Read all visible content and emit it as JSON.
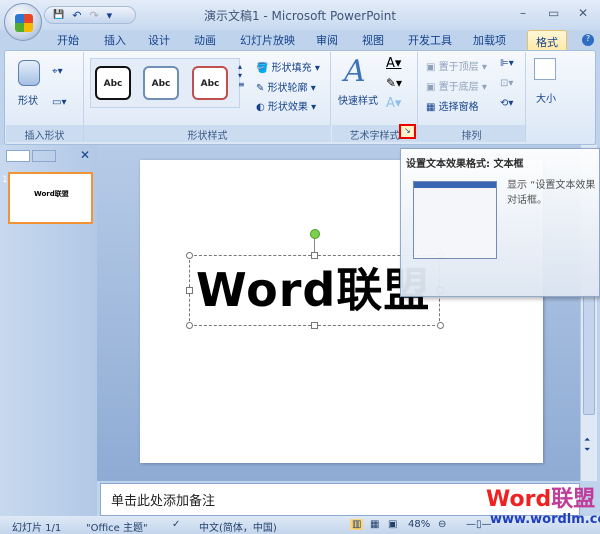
{
  "window": {
    "title": "演示文稿1 - Microsoft PowerPoint",
    "minimize": "–",
    "maximize": "▭",
    "close": "✕"
  },
  "qat": {
    "save": "💾",
    "undo": "↶",
    "redo": "↷",
    "customize": "▾"
  },
  "tabs": [
    "开始",
    "插入",
    "设计",
    "动画",
    "幻灯片放映",
    "审阅",
    "视图",
    "开发工具",
    "加载项"
  ],
  "active_tab": "格式",
  "help": "?",
  "ribbon": {
    "insert_shapes": {
      "shapes_label": "形状",
      "group_label": "插入形状"
    },
    "shape_styles": {
      "sample": "Abc",
      "fill": "形状填充",
      "outline": "形状轮廓",
      "effects": "形状效果",
      "group_label": "形状样式"
    },
    "wordart": {
      "quick_styles": "快速样式",
      "group_label": "艺术字样式"
    },
    "arrange": {
      "bring_front": "置于顶层",
      "send_back": "置于底层",
      "selection_pane": "选择窗格",
      "group_label": "排列"
    },
    "size": {
      "label": "大小"
    }
  },
  "slide": {
    "text": "Word联盟"
  },
  "thumbnail": {
    "number": "1",
    "text": "Word联盟"
  },
  "notes": {
    "placeholder": "单击此处添加备注"
  },
  "tooltip": {
    "title": "设置文本效果格式: 文本框",
    "body1": "显示 “设置文本效果",
    "body2": "对话框。"
  },
  "status": {
    "slide": "幻灯片 1/1",
    "theme": "\"Office 主题\"",
    "language": "中文(简体，中国)",
    "zoom": "48%"
  },
  "watermark": {
    "word": "Word",
    "cn": "联盟",
    "url": "www.wordlm.com"
  },
  "colors": {
    "accent": "#15428b",
    "active_tab": "#ffe9a6",
    "thumb_border": "#f29436",
    "highlight": "#e00000"
  }
}
